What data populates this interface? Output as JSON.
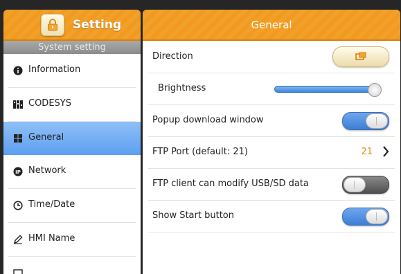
{
  "sidebar": {
    "header_label": "Setting",
    "section_title": "System setting",
    "items": [
      {
        "label": "Information",
        "icon": "info-icon"
      },
      {
        "label": "CODESYS",
        "icon": "codesys-icon"
      },
      {
        "label": "General",
        "icon": "grid-icon",
        "active": true
      },
      {
        "label": "Network",
        "icon": "network-ip-icon"
      },
      {
        "label": "Time/Date",
        "icon": "clock-icon"
      },
      {
        "label": "HMI Name",
        "icon": "pencil-icon"
      }
    ]
  },
  "main": {
    "title": "General",
    "rows": {
      "direction": {
        "label": "Direction"
      },
      "brightness": {
        "label": "Brightness",
        "level": 0.95
      },
      "popup": {
        "label": "Popup download window",
        "state": "on"
      },
      "ftp_port": {
        "label": "FTP Port  (default: 21)",
        "value": "21"
      },
      "ftp_client": {
        "label": "FTP client can modify USB/SD data",
        "state": "off"
      },
      "start_button": {
        "label": "Show Start button",
        "state": "on"
      }
    }
  },
  "colors": {
    "header_orange": "#f39a1e",
    "active_blue": "#5d9ff2",
    "port_value": "#e08a1a"
  }
}
